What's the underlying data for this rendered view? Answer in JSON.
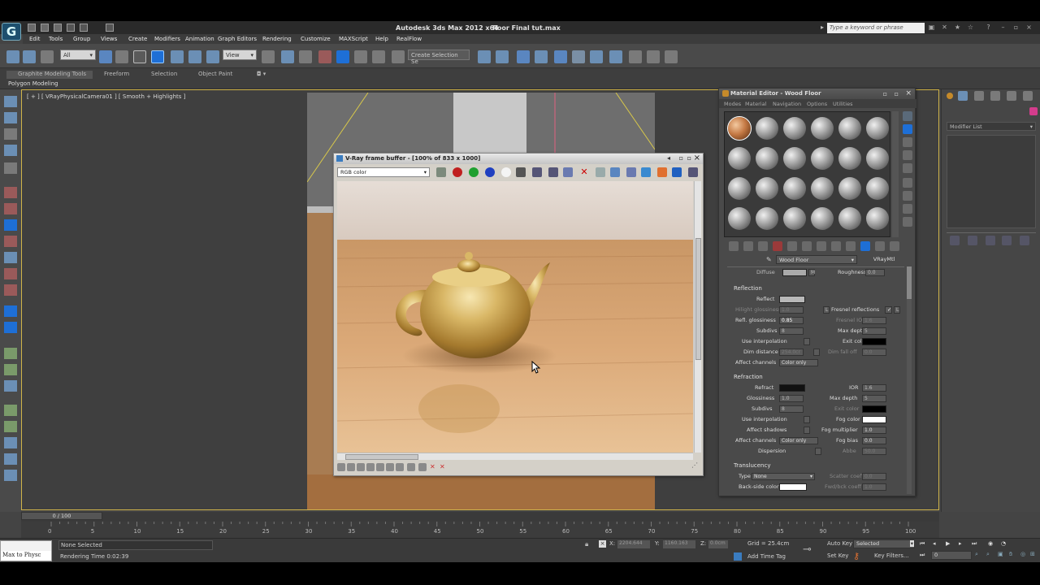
{
  "app": {
    "title": "Autodesk 3ds Max  2012 x64",
    "file": "floor Final tut.max",
    "logo": "G",
    "search_placeholder": "Type a keyword or phrase"
  },
  "menu": [
    "Edit",
    "Tools",
    "Group",
    "Views",
    "Create",
    "Modifiers",
    "Animation",
    "Graph Editors",
    "Rendering",
    "Customize",
    "MAXScript",
    "Help",
    "RealFlow"
  ],
  "toolbar": {
    "filter_all": "All",
    "view_dropdown": "View",
    "selection_set": "Create Selection Se"
  },
  "ribbon": {
    "tabs": [
      "Graphite Modeling Tools",
      "Freeform",
      "Selection",
      "Object Paint"
    ],
    "sub_label": "Polygon Modeling"
  },
  "viewport": {
    "label": "[ + ] [ VRayPhysicalCamera01 ] [ Smooth + Highlights ]"
  },
  "vfb": {
    "title": "V-Ray frame buffer - [100% of 833 x 1000]",
    "channel": "RGB color"
  },
  "mtl": {
    "title": "Material Editor - Wood Floor",
    "menus": [
      "Modes",
      "Material",
      "Navigation",
      "Options",
      "Utilities"
    ],
    "material_name": "Wood Floor",
    "material_type": "VRayMtl",
    "diffuse_label": "Diffuse",
    "roughness_label": "Roughness",
    "roughness_value": "0.0",
    "reflection": {
      "header": "Reflection",
      "reflect": "Reflect",
      "hilight_glossiness": "Hilight glossiness",
      "hilight_value": "1.0",
      "refl_glossiness": "Refl. glossiness",
      "refl_value": "0.85",
      "subdivs": "Subdivs",
      "subdivs_value": "8",
      "use_interpolation": "Use interpolation",
      "dim_distance": "Dim distance",
      "dim_value": "254.0cr",
      "affect_channels": "Affect channels",
      "channels_value": "Color only",
      "fresnel": "Fresnel reflections",
      "fresnel_ior": "Fresnel IOR",
      "fresnel_ior_value": "1.6",
      "max_depth": "Max depth",
      "max_depth_value": "5",
      "exit_color": "Exit color",
      "dim_falloff": "Dim fall off",
      "dim_falloff_value": "0.0",
      "lock": "L"
    },
    "refraction": {
      "header": "Refraction",
      "refract": "Refract",
      "ior": "IOR",
      "ior_value": "1.6",
      "glossiness": "Glossiness",
      "glossiness_value": "1.0",
      "max_depth": "Max depth",
      "max_depth_value": "5",
      "subdivs": "Subdivs",
      "subdivs_value": "8",
      "exit_color": "Exit color",
      "use_interpolation": "Use interpolation",
      "fog_color": "Fog color",
      "affect_shadows": "Affect shadows",
      "fog_multiplier": "Fog multiplier",
      "fog_multiplier_value": "1.0",
      "fog_bias": "Fog bias",
      "fog_bias_value": "0.0",
      "affect_channels": "Affect channels",
      "channels_value": "Color only",
      "dispersion": "Dispersion",
      "abbe": "Abbe",
      "abbe_value": "50.0"
    },
    "translucency": {
      "header": "Translucency",
      "type": "Type",
      "type_value": "None",
      "scatter": "Scatter coeff",
      "scatter_value": "0.0",
      "backside": "Back-side color",
      "fwd_bck": "Fwd/bck coeff",
      "fwd_value": "1.0"
    }
  },
  "right_panel": {
    "modifier_list": "Modifier List"
  },
  "timeline": {
    "frame_counter": "0 / 100",
    "ticks": [
      "0",
      "5",
      "10",
      "15",
      "20",
      "25",
      "30",
      "35",
      "40",
      "45",
      "50",
      "55",
      "60",
      "65",
      "70",
      "75",
      "80",
      "85",
      "90",
      "95",
      "100"
    ]
  },
  "status": {
    "script_tab": "Max to Physc",
    "selection": "None Selected",
    "render_time": "Rendering Time  0:02:39",
    "x": "2204.644",
    "y": "1160.163",
    "z": "0.0cm",
    "grid": "Grid = 25.4cm",
    "auto_key": "Auto Key",
    "auto_key_value": "Selected",
    "set_key": "Set Key",
    "key_filters": "Key Filters...",
    "add_time_tag": "Add Time Tag",
    "frame": "0"
  },
  "colors": {
    "accent_blue": "#1e6fd6",
    "viewport_border": "#d0b44a",
    "wood": "#d9a26a",
    "gold": "#c9a24a"
  }
}
